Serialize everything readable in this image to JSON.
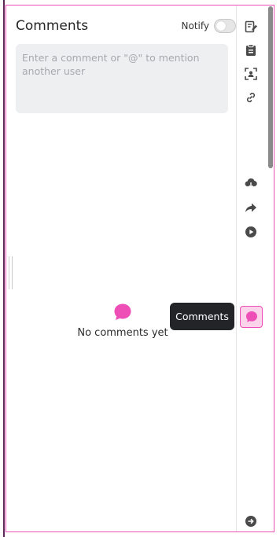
{
  "panel": {
    "title": "Comments",
    "notify_label": "Notify",
    "notify_enabled": false,
    "comment_placeholder": "Enter a comment or \"@\" to mention another user",
    "empty_text": "No comments yet"
  },
  "rail": {
    "items": [
      {
        "icon": "edit-note-icon"
      },
      {
        "icon": "clipboard-icon"
      },
      {
        "icon": "screenshot-user-icon"
      },
      {
        "icon": "link-icon"
      },
      {
        "icon": "cloud-download-icon"
      },
      {
        "icon": "share-arrow-icon"
      },
      {
        "icon": "play-icon"
      },
      {
        "icon": "comment-icon"
      },
      {
        "icon": "arrow-right-circle-icon"
      }
    ],
    "tooltip": "Comments"
  },
  "colors": {
    "accent": "#ee4fb7",
    "accent_light": "#fbd3ea",
    "icon": "#4a4a4a",
    "tooltip_bg": "#222427"
  }
}
